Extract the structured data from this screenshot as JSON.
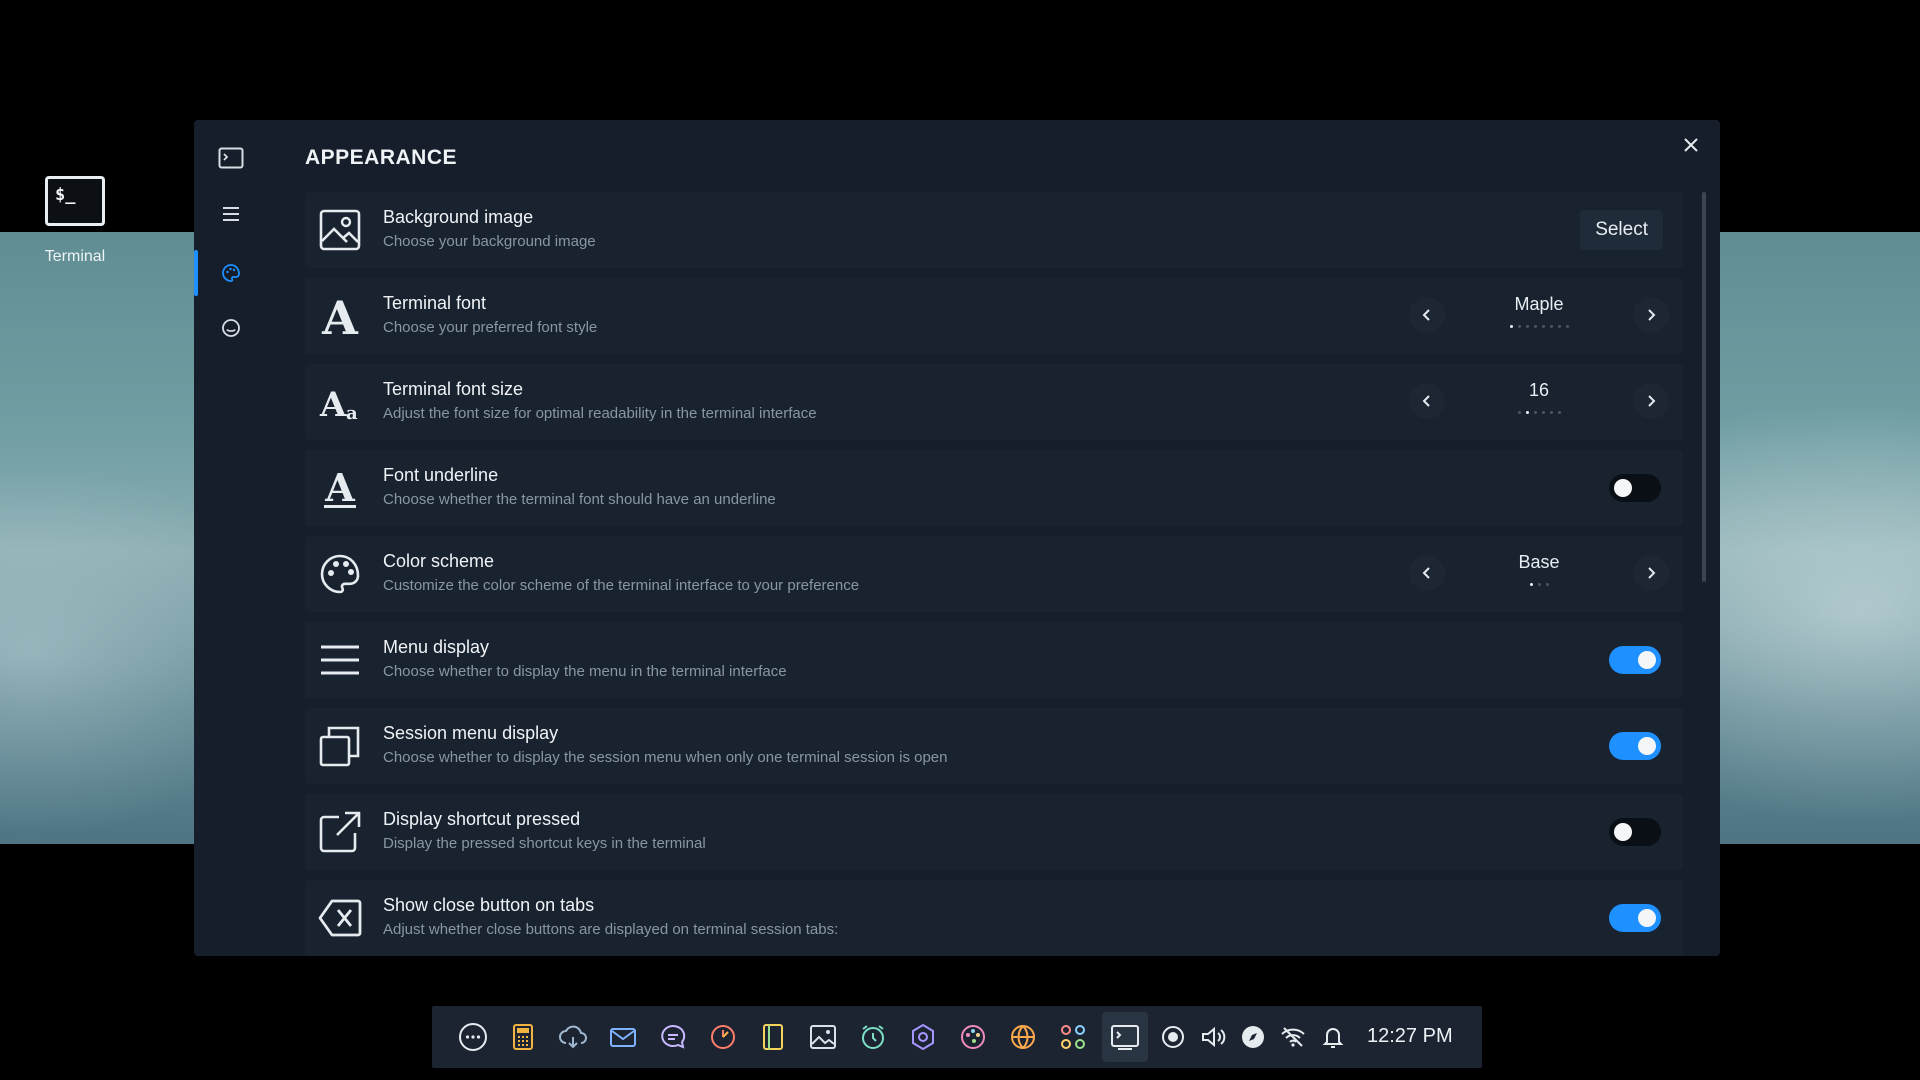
{
  "desktop": {
    "icon_label": "Terminal",
    "icon_glyph": "$_"
  },
  "window": {
    "title": "APPEARANCE",
    "close_glyph": "✕",
    "sidebar": [
      "terminal-icon",
      "menu-icon",
      "palette-icon",
      "smiley-icon"
    ]
  },
  "rows": {
    "bg": {
      "title": "Background image",
      "sub": "Choose your background image",
      "button": "Select"
    },
    "font": {
      "title": "Terminal font",
      "sub": "Choose your preferred font style",
      "value": "Maple"
    },
    "size": {
      "title": "Terminal font size",
      "sub": "Adjust the font size for optimal readability in the terminal interface",
      "value": "16"
    },
    "underline": {
      "title": "Font underline",
      "sub": "Choose whether the terminal font should have an underline",
      "on": false
    },
    "scheme": {
      "title": "Color scheme",
      "sub": "Customize the color scheme of the terminal interface to your preference",
      "value": "Base"
    },
    "menu": {
      "title": "Menu display",
      "sub": "Choose whether to display the menu in the terminal interface",
      "on": true
    },
    "session": {
      "title": "Session menu display",
      "sub": "Choose whether to display the session menu when only one terminal session is open",
      "on": true
    },
    "shortcut": {
      "title": "Display shortcut pressed",
      "sub": "Display the pressed shortcut keys in the terminal",
      "on": false
    },
    "closebtn": {
      "title": "Show close button on tabs",
      "sub": "Adjust whether close buttons are displayed on terminal session tabs:",
      "on": true
    }
  },
  "colors": {
    "accent": "#1e90ff",
    "window_bg": "#151e2a",
    "row_bg": "#18232f"
  },
  "taskbar": {
    "clock": "12:27 PM",
    "icons": [
      "launcher-icon",
      "calculator-icon",
      "cloud-icon",
      "mail-icon",
      "chat-icon",
      "timer-icon",
      "notes-icon",
      "gallery-icon",
      "alarm-icon",
      "settings-hex-icon",
      "palette-icon",
      "globe-icon",
      "apps-grid-icon",
      "terminal-icon",
      "record-icon",
      "volume-icon",
      "compass-icon",
      "wifi-icon",
      "bell-icon"
    ]
  }
}
